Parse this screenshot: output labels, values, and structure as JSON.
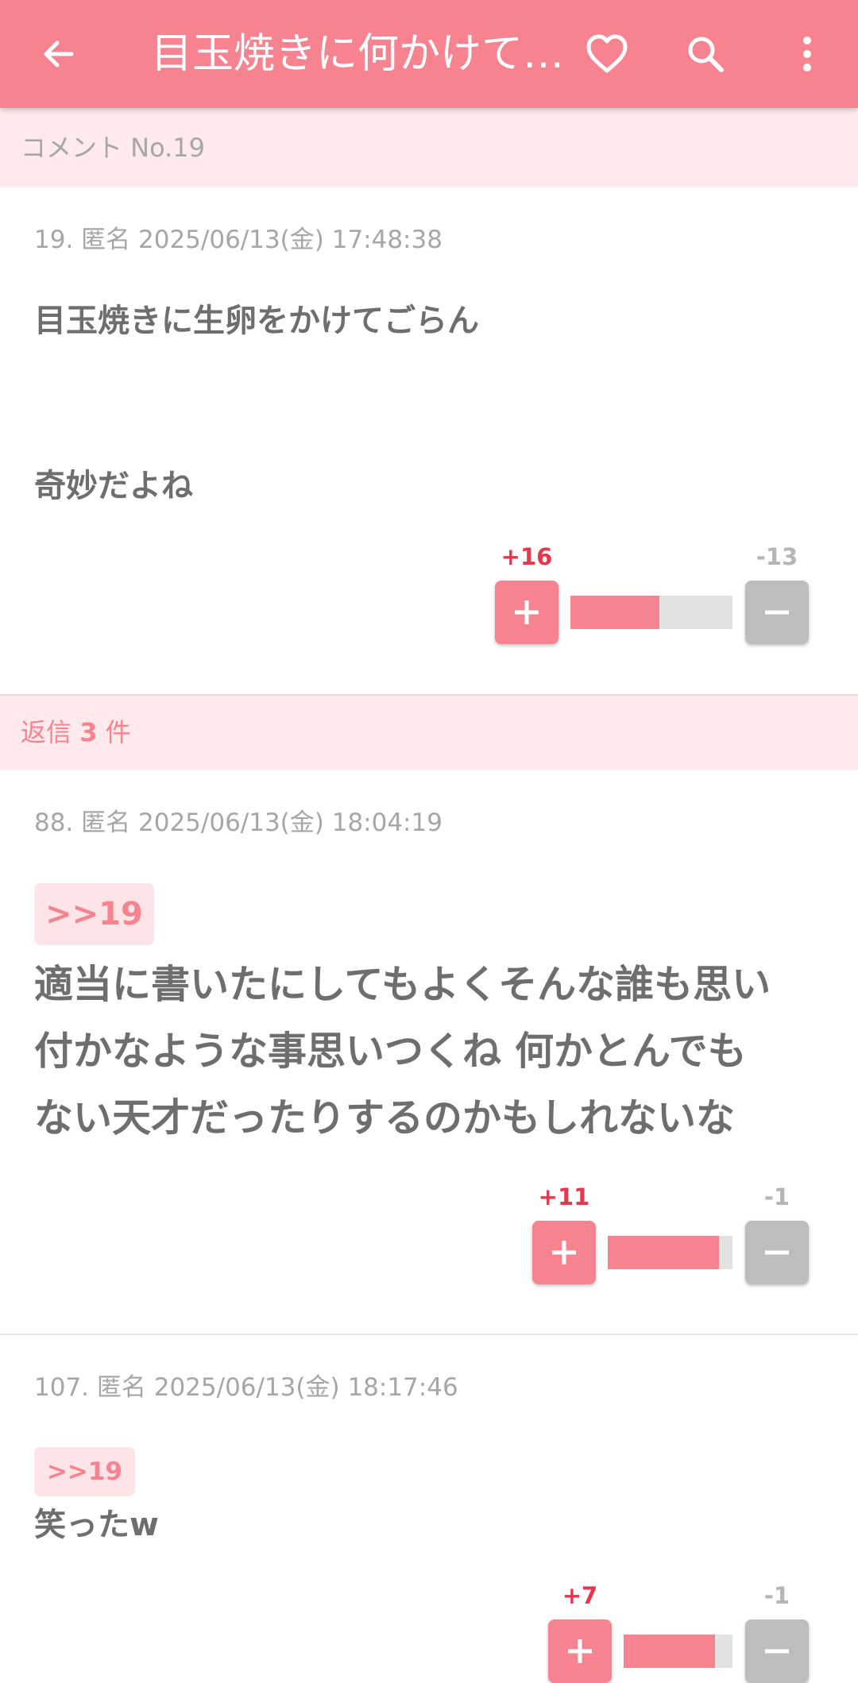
{
  "app_bar": {
    "title": "目玉焼きに何かけて…",
    "icons": [
      "back-arrow-icon",
      "heart-icon",
      "search-icon",
      "more-vert-icon"
    ],
    "accent_color": "#f6838f"
  },
  "comment_header": {
    "label": "コメント No.19"
  },
  "main_comment": {
    "meta": "19. 匿名 2025/06/13(金) 17:48:38",
    "lines": [
      "目玉焼きに生卵をかけてごらん",
      "奇妙だよね"
    ],
    "plus": "+16",
    "minus": "-13",
    "plus_ratio": 0.55
  },
  "replies_header": {
    "prefix": "返信",
    "count": "3",
    "suffix": "件"
  },
  "replies": [
    {
      "meta": "88. 匿名 2025/06/13(金) 18:04:19",
      "anchor": ">>19",
      "lines": [
        "適当に書いたにしてもよくそんな誰も思い",
        "付かなような事思いつくね 何かとんでも",
        "ない天才だったりするのかもしれないな"
      ],
      "plus": "+11",
      "minus": "-1",
      "plus_ratio": 0.89
    },
    {
      "meta": "107. 匿名 2025/06/13(金) 18:17:46",
      "anchor": ">>19",
      "lines": [
        "笑ったw"
      ],
      "plus": "+7",
      "minus": "-1",
      "plus_ratio": 0.84
    }
  ]
}
